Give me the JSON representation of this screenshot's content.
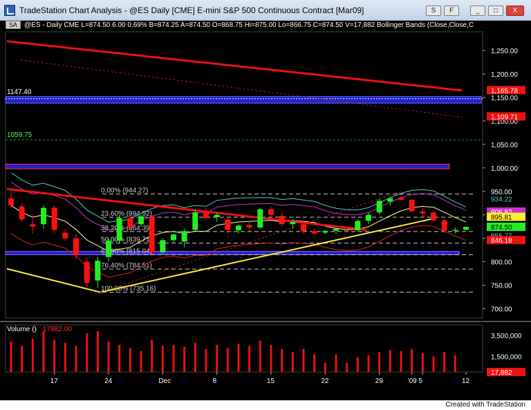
{
  "window": {
    "title": "TradeStation Chart Analysis - @ES  Daily  [CME] E-mini S&P 500 Continuous Contract [Mar09]",
    "buttons": [
      "S",
      "F",
      "_",
      "□",
      "X"
    ]
  },
  "status": {
    "symbol_box": "SA",
    "text": "@ES - Daily  CME  L=874.50  6.00  0.69%  B=874.25  A=874.50  O=868.75  Hi=875.00  Lo=866.75  C=874.50  V=17,882  Bollinger Bands (Close,Close,C"
  },
  "colors": {
    "up": "#22ee22",
    "down": "#ff1111",
    "trend_red": "#ee1111",
    "trend_yellow": "#ffee33",
    "band_blue": "#2222cc",
    "bb_cyan": "#55cccc",
    "bb_magenta": "#cc33cc"
  },
  "price_axis": {
    "ticks": [
      "1,250.00",
      "1,200.00",
      "1,150.00",
      "1,100.00",
      "1,050.00",
      "1,000.00",
      "950.00",
      "900.00",
      "850.00",
      "800.00",
      "750.00",
      "700.00"
    ],
    "tags": [
      {
        "label": "1,165.78",
        "value": 1165.78,
        "bg": "#ee1111",
        "fg": "#ffffff"
      },
      {
        "label": "1,109.71",
        "value": 1109.71,
        "bg": "#ee1111",
        "fg": "#ffffff"
      },
      {
        "label": "934.22",
        "value": 934.22,
        "bg": "#000000",
        "fg": "#55cccc"
      },
      {
        "label": "906.82",
        "value": 906.82,
        "bg": "#cc33cc",
        "fg": "#ffffff"
      },
      {
        "label": "895.81",
        "value": 895.81,
        "bg": "#ffee33",
        "fg": "#000000"
      },
      {
        "label": "874.50",
        "value": 874.5,
        "bg": "#22ee22",
        "fg": "#000000"
      },
      {
        "label": "855.77",
        "value": 855.77,
        "bg": "#000000",
        "fg": "#55cccc"
      },
      {
        "label": "846.18",
        "value": 846.18,
        "bg": "#ee1111",
        "fg": "#ffffff"
      }
    ]
  },
  "levels": {
    "upper_band_label": "1147.40",
    "mid_level_label": "1059.75"
  },
  "fibonacci": [
    {
      "label": "0.00% (944.27)",
      "value": 944.27
    },
    {
      "label": "23.60% (894.92)",
      "value": 894.92
    },
    {
      "label": "38.20% (864.39)",
      "value": 864.39
    },
    {
      "label": "50.00% (839.71)",
      "value": 839.71
    },
    {
      "label": "61.80% (815.04)",
      "value": 815.04
    },
    {
      "label": "76.40% (784.51)",
      "value": 784.51
    },
    {
      "label": "100.00% (735.16)",
      "value": 735.16
    }
  ],
  "volume": {
    "label": "Volume ()",
    "value_label": "17882.00",
    "ticks": [
      "3,500,000",
      "1,500,000"
    ],
    "last_tag": "17,882"
  },
  "date_axis": [
    "17",
    "24",
    "Dec",
    "8",
    "15",
    "22",
    "29",
    "'09",
    "5",
    "12"
  ],
  "chart_data": {
    "type": "candlestick",
    "price_range": [
      680,
      1290
    ],
    "candles": [
      {
        "o": 935,
        "h": 950,
        "l": 915,
        "c": 920
      },
      {
        "o": 918,
        "h": 925,
        "l": 885,
        "c": 890
      },
      {
        "o": 880,
        "h": 900,
        "l": 860,
        "c": 875
      },
      {
        "o": 880,
        "h": 920,
        "l": 870,
        "c": 915
      },
      {
        "o": 915,
        "h": 920,
        "l": 860,
        "c": 868
      },
      {
        "o": 862,
        "h": 870,
        "l": 845,
        "c": 850
      },
      {
        "o": 850,
        "h": 860,
        "l": 805,
        "c": 815
      },
      {
        "o": 800,
        "h": 810,
        "l": 745,
        "c": 755
      },
      {
        "o": 760,
        "h": 810,
        "l": 745,
        "c": 802
      },
      {
        "o": 810,
        "h": 850,
        "l": 800,
        "c": 845
      },
      {
        "o": 845,
        "h": 900,
        "l": 840,
        "c": 893
      },
      {
        "o": 893,
        "h": 898,
        "l": 865,
        "c": 873
      },
      {
        "o": 880,
        "h": 900,
        "l": 875,
        "c": 897
      },
      {
        "o": 895,
        "h": 898,
        "l": 815,
        "c": 820
      },
      {
        "o": 820,
        "h": 850,
        "l": 815,
        "c": 846
      },
      {
        "o": 846,
        "h": 860,
        "l": 840,
        "c": 858
      },
      {
        "o": 843,
        "h": 870,
        "l": 830,
        "c": 865
      },
      {
        "o": 868,
        "h": 912,
        "l": 865,
        "c": 905
      },
      {
        "o": 905,
        "h": 915,
        "l": 890,
        "c": 893
      },
      {
        "o": 895,
        "h": 905,
        "l": 885,
        "c": 900
      },
      {
        "o": 890,
        "h": 895,
        "l": 860,
        "c": 868
      },
      {
        "o": 867,
        "h": 880,
        "l": 860,
        "c": 877
      },
      {
        "o": 878,
        "h": 885,
        "l": 865,
        "c": 873
      },
      {
        "o": 873,
        "h": 915,
        "l": 870,
        "c": 912
      },
      {
        "o": 912,
        "h": 918,
        "l": 895,
        "c": 900
      },
      {
        "o": 898,
        "h": 905,
        "l": 875,
        "c": 880
      },
      {
        "o": 880,
        "h": 890,
        "l": 870,
        "c": 885
      },
      {
        "o": 880,
        "h": 888,
        "l": 860,
        "c": 865
      },
      {
        "o": 865,
        "h": 872,
        "l": 855,
        "c": 860
      },
      {
        "o": 862,
        "h": 868,
        "l": 858,
        "c": 866
      },
      {
        "o": 866,
        "h": 872,
        "l": 860,
        "c": 870
      },
      {
        "o": 868,
        "h": 875,
        "l": 862,
        "c": 866
      },
      {
        "o": 867,
        "h": 890,
        "l": 865,
        "c": 887
      },
      {
        "o": 887,
        "h": 905,
        "l": 880,
        "c": 900
      },
      {
        "o": 905,
        "h": 935,
        "l": 900,
        "c": 930
      },
      {
        "o": 928,
        "h": 940,
        "l": 920,
        "c": 935
      },
      {
        "o": 937,
        "h": 944,
        "l": 930,
        "c": 932
      },
      {
        "o": 932,
        "h": 934,
        "l": 905,
        "c": 908
      },
      {
        "o": 907,
        "h": 915,
        "l": 895,
        "c": 903
      },
      {
        "o": 905,
        "h": 910,
        "l": 885,
        "c": 888
      },
      {
        "o": 888,
        "h": 892,
        "l": 862,
        "c": 866
      },
      {
        "o": 866,
        "h": 873,
        "l": 860,
        "c": 868
      },
      {
        "o": 868,
        "h": 875,
        "l": 866.75,
        "c": 874.5
      }
    ],
    "volume_values": [
      2900000,
      2500000,
      3200000,
      3900000,
      3100000,
      2800000,
      2500000,
      3700000,
      3900000,
      2900000,
      2600000,
      2300000,
      2000000,
      3100000,
      2500000,
      2600000,
      2400000,
      2800000,
      2200000,
      2600000,
      2300000,
      2700000,
      2500000,
      3000000,
      2600000,
      2200000,
      1900000,
      2200000,
      1700000,
      900000,
      1700000,
      900000,
      1400000,
      1600000,
      1900000,
      2100000,
      2000000,
      2200000,
      1800000,
      1500000,
      1900000,
      1600000,
      17882
    ]
  }
}
